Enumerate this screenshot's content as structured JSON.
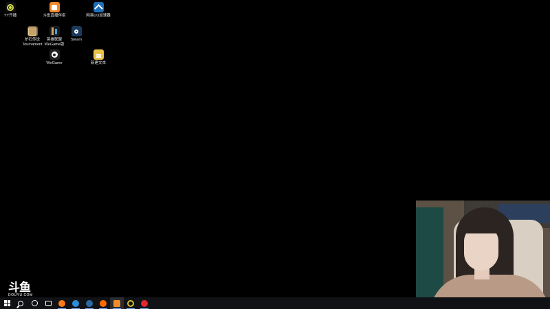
{
  "desktop_icons": [
    {
      "label": "YY开播",
      "icon": "yy-icon"
    },
    {
      "label": "斗鱼直播伴侣",
      "icon": "douyu-icon"
    },
    {
      "label": "网易UU加速器",
      "icon": "netease-uu-icon"
    },
    {
      "label": "炉石传说 Tournament",
      "icon": "hearthstone-icon"
    },
    {
      "label": "英雄联盟 WeGame版",
      "icon": "lol-icon"
    },
    {
      "label": "Steam",
      "icon": "steam-icon"
    },
    {
      "label": "WeGame",
      "icon": "wegame-icon"
    },
    {
      "label": "新建文本",
      "icon": "file-icon"
    }
  ],
  "watermark": {
    "logo": "斗鱼",
    "url": "DOUYU.COM"
  },
  "taskbar": {
    "items": [
      {
        "name": "start",
        "icon": "windows-logo-icon"
      },
      {
        "name": "search",
        "icon": "search-icon"
      },
      {
        "name": "cortana",
        "icon": "cortana-icon"
      },
      {
        "name": "task-view",
        "icon": "task-view-icon"
      },
      {
        "name": "firefox",
        "icon": "firefox-icon",
        "color": "#ff7a1a"
      },
      {
        "name": "app-blue",
        "icon": "blue-app-icon",
        "color": "#2a8fd6"
      },
      {
        "name": "steam",
        "icon": "steam-icon",
        "color": "#2c6aa0"
      },
      {
        "name": "app-orange",
        "icon": "orange-app-icon",
        "color": "#ff6a00"
      },
      {
        "name": "douyu",
        "icon": "douyu-icon",
        "color": "#f08a2a"
      },
      {
        "name": "yy",
        "icon": "yy-icon",
        "color": "#d9c12a"
      },
      {
        "name": "netease-music",
        "icon": "netease-music-icon",
        "color": "#e0282e"
      }
    ]
  },
  "webcam": {
    "content": "streamer-camera-feed"
  }
}
